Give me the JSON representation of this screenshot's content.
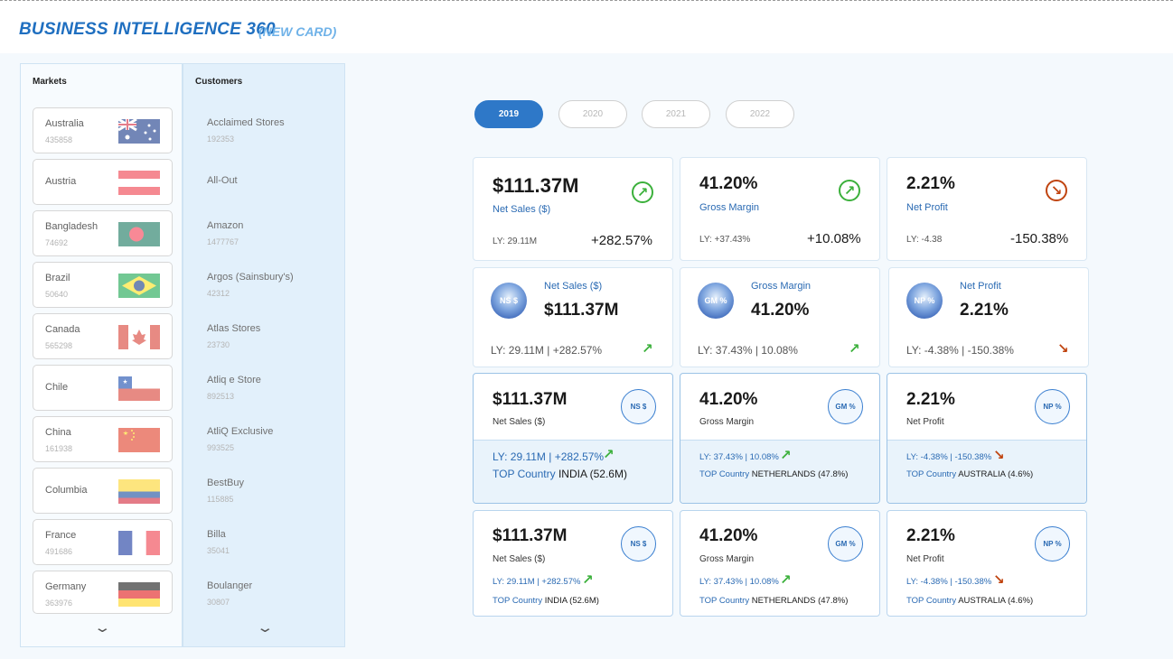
{
  "header": {
    "title": "BUSINESS INTELLIGENCE 360",
    "subtitle": "(NEW CARD)"
  },
  "markets": {
    "title": "Markets",
    "items": [
      {
        "name": "Australia",
        "value": "435858",
        "flag": "australia"
      },
      {
        "name": "Austria",
        "value": "",
        "flag": "austria"
      },
      {
        "name": "Bangladesh",
        "value": "74692",
        "flag": "bangladesh"
      },
      {
        "name": "Brazil",
        "value": "50640",
        "flag": "brazil"
      },
      {
        "name": "Canada",
        "value": "565298",
        "flag": "canada"
      },
      {
        "name": "Chile",
        "value": "",
        "flag": "chile"
      },
      {
        "name": "China",
        "value": "161938",
        "flag": "china"
      },
      {
        "name": "Columbia",
        "value": "",
        "flag": "colombia"
      },
      {
        "name": "France",
        "value": "491686",
        "flag": "france"
      },
      {
        "name": "Germany",
        "value": "363976",
        "flag": "germany"
      }
    ]
  },
  "customers": {
    "title": "Customers",
    "items": [
      {
        "name": "Acclaimed Stores",
        "value": "192353"
      },
      {
        "name": "All-Out",
        "value": ""
      },
      {
        "name": "Amazon",
        "value": "1477767"
      },
      {
        "name": "Argos (Sainsbury's)",
        "value": "42312"
      },
      {
        "name": "Atlas Stores",
        "value": "23730"
      },
      {
        "name": "Atliq e Store",
        "value": "892513"
      },
      {
        "name": "AtliQ Exclusive",
        "value": "993525"
      },
      {
        "name": "BestBuy",
        "value": "115885"
      },
      {
        "name": "Billa",
        "value": "35041"
      },
      {
        "name": "Boulanger",
        "value": "30807"
      }
    ]
  },
  "years": [
    {
      "label": "2019",
      "active": true
    },
    {
      "label": "2020",
      "active": false
    },
    {
      "label": "2021",
      "active": false
    },
    {
      "label": "2022",
      "active": false
    }
  ],
  "row1": [
    {
      "value": "$111.37M",
      "label": "Net Sales ($)",
      "ly": "LY: 29.11M",
      "delta": "+282.57%",
      "trend": "up"
    },
    {
      "value": "41.20%",
      "label": "Gross Margin",
      "ly": "LY: +37.43%",
      "delta": "+10.08%",
      "trend": "up"
    },
    {
      "value": "2.21%",
      "label": "Net Profit",
      "ly": "LY: -4.38",
      "delta": "-150.38%",
      "trend": "down"
    }
  ],
  "row2": [
    {
      "badge": "NS $",
      "label": "Net Sales ($)",
      "value": "$111.37M",
      "ly": "LY: 29.11M | +282.57%",
      "trend": "up"
    },
    {
      "badge": "GM %",
      "label": "Gross Margin",
      "value": "41.20%",
      "ly": "LY: 37.43% | 10.08%",
      "trend": "up"
    },
    {
      "badge": "NP %",
      "label": "Net Profit",
      "value": "2.21%",
      "ly": "LY: -4.38% | -150.38%",
      "trend": "down"
    }
  ],
  "row3": [
    {
      "value": "$111.37M",
      "label": "Net Sales ($)",
      "badge": "NS $",
      "ly": "LY: 29.11M | +282.57%",
      "top_prefix": "TOP Country",
      "top_country": "INDIA (52.6M)",
      "trend": "up"
    },
    {
      "value": "41.20%",
      "label": "Gross Margin",
      "badge": "GM %",
      "ly": "LY: 37.43% | 10.08%",
      "top_prefix": "TOP Country",
      "top_country": "NETHERLANDS (47.8%)",
      "trend": "up"
    },
    {
      "value": "2.21%",
      "label": "Net Profit",
      "badge": "NP %",
      "ly": "LY: -4.38% | -150.38%",
      "top_prefix": "TOP Country",
      "top_country": "AUSTRALIA (4.6%)",
      "trend": "down"
    }
  ],
  "row4": [
    {
      "value": "$111.37M",
      "label": "Net Sales ($)",
      "badge": "NS $",
      "ly": "LY: 29.11M | +282.57%",
      "top_prefix": "TOP Country",
      "top_country": "INDIA (52.6M)",
      "trend": "up"
    },
    {
      "value": "41.20%",
      "label": "Gross Margin",
      "badge": "GM %",
      "ly": "LY: 37.43% | 10.08%",
      "top_prefix": "TOP Country",
      "top_country": "NETHERLANDS (47.8%)",
      "trend": "up"
    },
    {
      "value": "2.21%",
      "label": "Net Profit",
      "badge": "NP %",
      "ly": "LY: -4.38% | -150.38%",
      "top_prefix": "TOP Country",
      "top_country": "AUSTRALIA (4.6%)",
      "trend": "down"
    }
  ],
  "colors": {
    "accent": "#2e78c8",
    "up": "#3bb03b",
    "down": "#c0440f",
    "label_blue": "#2a6ab3"
  }
}
